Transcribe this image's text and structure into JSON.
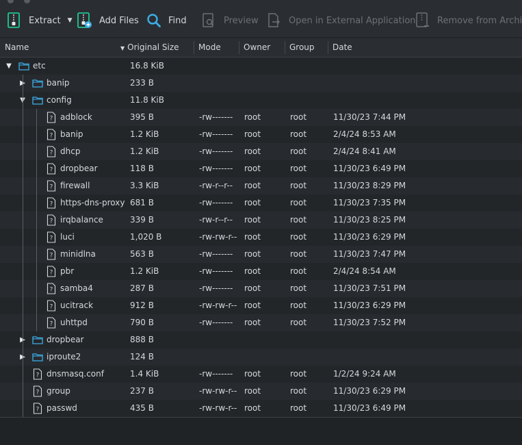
{
  "toolbar": {
    "extract": "Extract",
    "add_files": "Add Files",
    "find": "Find",
    "preview": "Preview",
    "open_external": "Open in External Application",
    "remove": "Remove from Archive"
  },
  "columns": {
    "name": "Name",
    "size": "Original Size",
    "mode": "Mode",
    "owner": "Owner",
    "group": "Group",
    "date": "Date"
  },
  "rows": [
    {
      "name": "etc",
      "size": "16.8 KiB",
      "mode": "",
      "owner": "",
      "group": "",
      "date": ""
    },
    {
      "name": "banip",
      "size": "233 B",
      "mode": "",
      "owner": "",
      "group": "",
      "date": ""
    },
    {
      "name": "config",
      "size": "11.8 KiB",
      "mode": "",
      "owner": "",
      "group": "",
      "date": ""
    },
    {
      "name": "adblock",
      "size": "395 B",
      "mode": "-rw-------",
      "owner": "root",
      "group": "root",
      "date": "11/30/23 7:44 PM"
    },
    {
      "name": "banip",
      "size": "1.2 KiB",
      "mode": "-rw-------",
      "owner": "root",
      "group": "root",
      "date": "2/4/24 8:53 AM"
    },
    {
      "name": "dhcp",
      "size": "1.2 KiB",
      "mode": "-rw-------",
      "owner": "root",
      "group": "root",
      "date": "2/4/24 8:41 AM"
    },
    {
      "name": "dropbear",
      "size": "118 B",
      "mode": "-rw-------",
      "owner": "root",
      "group": "root",
      "date": "11/30/23 6:49 PM"
    },
    {
      "name": "firewall",
      "size": "3.3 KiB",
      "mode": "-rw-r--r--",
      "owner": "root",
      "group": "root",
      "date": "11/30/23 8:29 PM"
    },
    {
      "name": "https-dns-proxy",
      "size": "681 B",
      "mode": "-rw-------",
      "owner": "root",
      "group": "root",
      "date": "11/30/23 7:35 PM"
    },
    {
      "name": "irqbalance",
      "size": "339 B",
      "mode": "-rw-r--r--",
      "owner": "root",
      "group": "root",
      "date": "11/30/23 8:25 PM"
    },
    {
      "name": "luci",
      "size": "1,020 B",
      "mode": "-rw-rw-r--",
      "owner": "root",
      "group": "root",
      "date": "11/30/23 6:29 PM"
    },
    {
      "name": "minidlna",
      "size": "563 B",
      "mode": "-rw-------",
      "owner": "root",
      "group": "root",
      "date": "11/30/23 7:47 PM"
    },
    {
      "name": "pbr",
      "size": "1.2 KiB",
      "mode": "-rw-------",
      "owner": "root",
      "group": "root",
      "date": "2/4/24 8:54 AM"
    },
    {
      "name": "samba4",
      "size": "287 B",
      "mode": "-rw-------",
      "owner": "root",
      "group": "root",
      "date": "11/30/23 7:51 PM"
    },
    {
      "name": "ucitrack",
      "size": "912 B",
      "mode": "-rw-rw-r--",
      "owner": "root",
      "group": "root",
      "date": "11/30/23 6:29 PM"
    },
    {
      "name": "uhttpd",
      "size": "790 B",
      "mode": "-rw-------",
      "owner": "root",
      "group": "root",
      "date": "11/30/23 7:52 PM"
    },
    {
      "name": "dropbear",
      "size": "888 B",
      "mode": "",
      "owner": "",
      "group": "",
      "date": ""
    },
    {
      "name": "iproute2",
      "size": "124 B",
      "mode": "",
      "owner": "",
      "group": "",
      "date": ""
    },
    {
      "name": "dnsmasq.conf",
      "size": "1.4 KiB",
      "mode": "-rw-------",
      "owner": "root",
      "group": "root",
      "date": "1/2/24 9:24 AM"
    },
    {
      "name": "group",
      "size": "237 B",
      "mode": "-rw-rw-r--",
      "owner": "root",
      "group": "root",
      "date": "11/30/23 6:29 PM"
    },
    {
      "name": "passwd",
      "size": "435 B",
      "mode": "-rw-rw-r--",
      "owner": "root",
      "group": "root",
      "date": "11/30/23 6:49 PM"
    }
  ],
  "colors": {
    "accent": "#3daee9",
    "folder": "#3daee9",
    "archive_green": "#1cdc9a"
  }
}
